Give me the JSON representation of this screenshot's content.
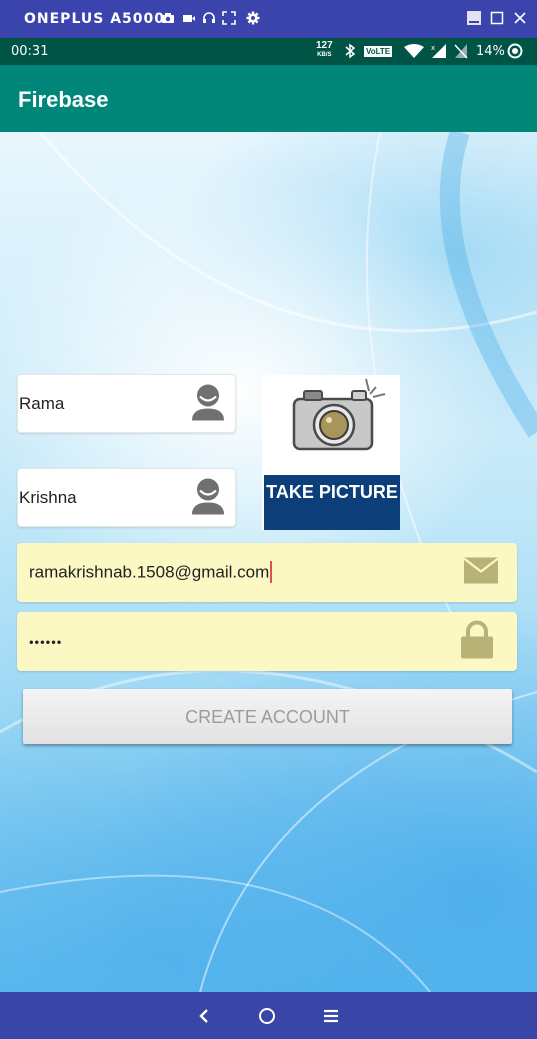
{
  "window": {
    "title": "ONEPLUS A5000",
    "tools": [
      "camera-icon",
      "video-icon",
      "headset-icon",
      "fullscreen-icon",
      "gear-icon"
    ],
    "controls": [
      "minimize-icon",
      "maximize-icon",
      "close-icon"
    ]
  },
  "status": {
    "time": "00:31",
    "speed_value": "127",
    "speed_unit": "KB/S",
    "volte": "VoLTE",
    "battery": "14%"
  },
  "appbar": {
    "title": "Firebase"
  },
  "form": {
    "first_name": "Rama",
    "last_name": "Krishna",
    "email": "ramakrishnab.1508@gmail.com",
    "password": "••••••",
    "take_picture_label": "TAKE PICTURE",
    "create_account_label": "CREATE ACCOUNT"
  },
  "colors": {
    "window_bar": "#3b44ad",
    "status_bar": "#005446",
    "app_bar": "#00877a",
    "input_highlight": "#fcf8c4",
    "picture_band": "#0c3f7a"
  }
}
